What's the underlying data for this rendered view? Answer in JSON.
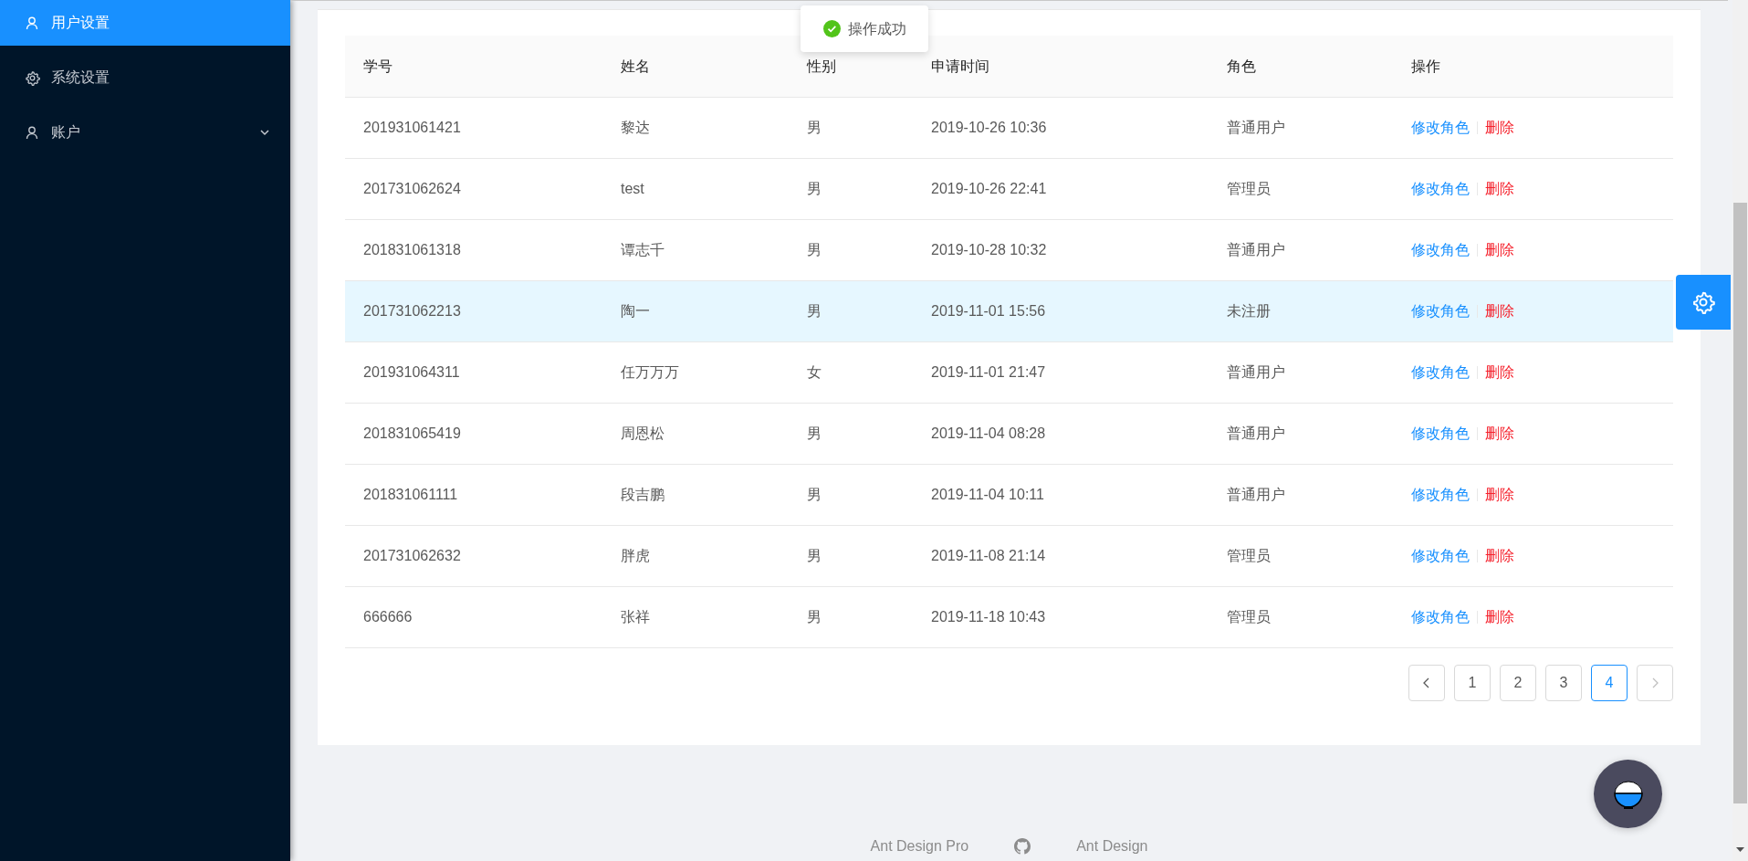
{
  "sidebar": {
    "items": [
      {
        "label": "用户设置",
        "kind": "user",
        "selected": true,
        "expandable": false
      },
      {
        "label": "系统设置",
        "kind": "gear",
        "selected": false,
        "expandable": false
      },
      {
        "label": "账户",
        "kind": "user",
        "selected": false,
        "expandable": true
      }
    ]
  },
  "toast": {
    "kind": "success",
    "text": "操作成功"
  },
  "table": {
    "columns": [
      "学号",
      "姓名",
      "性别",
      "申请时间",
      "角色",
      "操作"
    ],
    "rows": [
      {
        "cells": [
          "201931061421",
          "黎达",
          "男",
          "2019-10-26 10:36",
          "普通用户"
        ],
        "actions": [
          "修改角色",
          "删除"
        ],
        "highlighted": false
      },
      {
        "cells": [
          "201731062624",
          "test",
          "男",
          "2019-10-26 22:41",
          "管理员"
        ],
        "actions": [
          "修改角色",
          "删除"
        ],
        "highlighted": false
      },
      {
        "cells": [
          "201831061318",
          "谭志千",
          "男",
          "2019-10-28 10:32",
          "普通用户"
        ],
        "actions": [
          "修改角色",
          "删除"
        ],
        "highlighted": false
      },
      {
        "cells": [
          "201731062213",
          "陶一",
          "男",
          "2019-11-01 15:56",
          "未注册"
        ],
        "actions": [
          "修改角色",
          "删除"
        ],
        "highlighted": true
      },
      {
        "cells": [
          "201931064311",
          "任万万万",
          "女",
          "2019-11-01 21:47",
          "普通用户"
        ],
        "actions": [
          "修改角色",
          "删除"
        ],
        "highlighted": false
      },
      {
        "cells": [
          "201831065419",
          "周恩松",
          "男",
          "2019-11-04 08:28",
          "普通用户"
        ],
        "actions": [
          "修改角色",
          "删除"
        ],
        "highlighted": false
      },
      {
        "cells": [
          "201831061111",
          "段吉鹏",
          "男",
          "2019-11-04 10:11",
          "普通用户"
        ],
        "actions": [
          "修改角色",
          "删除"
        ],
        "highlighted": false
      },
      {
        "cells": [
          "201731062632",
          "胖虎",
          "男",
          "2019-11-08 21:14",
          "管理员"
        ],
        "actions": [
          "修改角色",
          "删除"
        ],
        "highlighted": false
      },
      {
        "cells": [
          "666666",
          "张祥",
          "男",
          "2019-11-18 10:43",
          "管理员"
        ],
        "actions": [
          "修改角色",
          "删除"
        ],
        "highlighted": false
      }
    ]
  },
  "pagination": {
    "pages": [
      {
        "label": "1",
        "selected": false
      },
      {
        "label": "2",
        "selected": false
      },
      {
        "label": "3",
        "selected": false
      },
      {
        "label": "4",
        "selected": true
      }
    ],
    "prev_disabled": false,
    "next_disabled": true
  },
  "footer": {
    "links": [
      "Ant Design Pro",
      "Ant Design"
    ]
  }
}
